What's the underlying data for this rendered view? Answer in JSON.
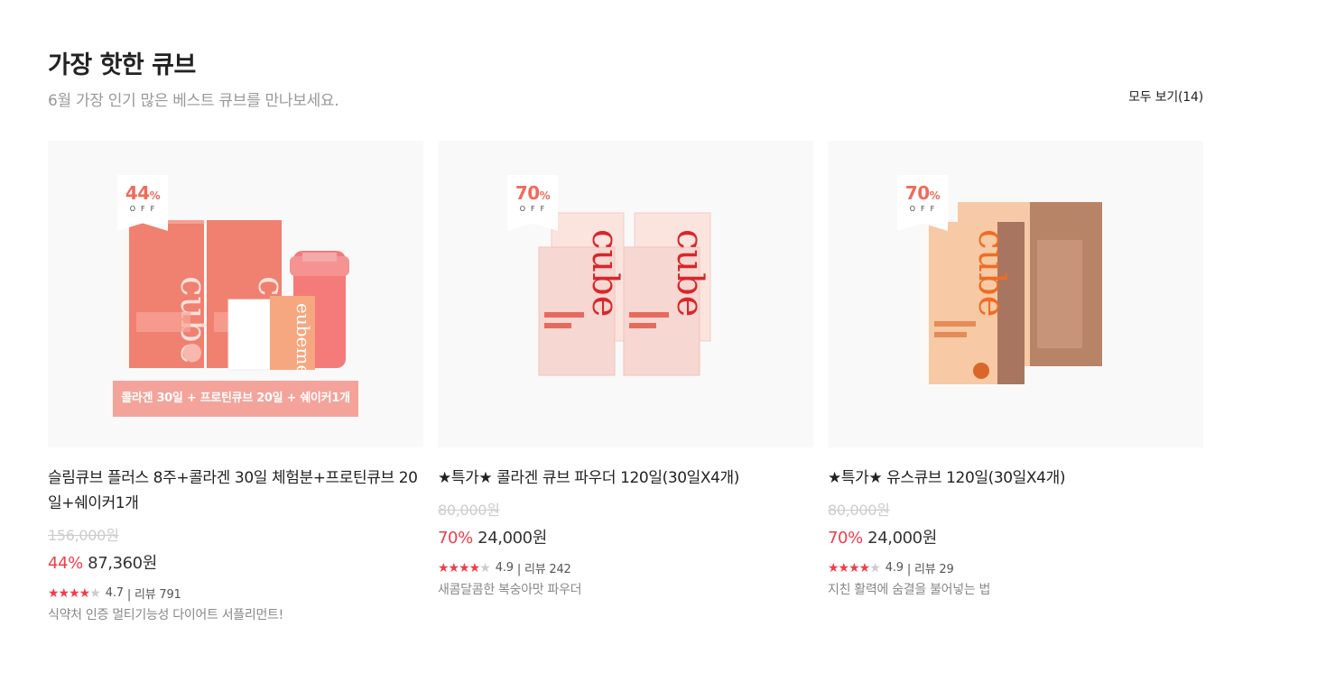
{
  "section": {
    "title": "가장 핫한 큐브",
    "subtitle": "6월 가장 인기 많은 베스트 큐브를 만나보세요.",
    "view_all": "모두 보기(14)"
  },
  "colors": {
    "discount": "#f23c4a",
    "badge": "#f06b5c",
    "thumb_bg": "#f9f9f9"
  },
  "products": [
    {
      "badge_pct": "44",
      "badge_unit": "%",
      "badge_off": "OFF",
      "strip": "콜라겐 30일 + 프로틴큐브 20일 + 쉐이커1개",
      "name": "슬림큐브 플러스 8주+콜라겐 30일 체험분+프로틴큐브 20일+쉐이커1개",
      "original_price": "156,000원",
      "discount": "44%",
      "price": "87,360원",
      "rating": "4.7",
      "review_count": "| 리뷰 791",
      "stars": "★★★★",
      "stars_empty": "★",
      "desc": "식약처 인증 멀티기능성 다이어트 서플리먼트!"
    },
    {
      "badge_pct": "70",
      "badge_unit": "%",
      "badge_off": "OFF",
      "name": "★특가★ 콜라겐 큐브 파우더 120일(30일X4개)",
      "original_price": "80,000원",
      "discount": "70%",
      "price": "24,000원",
      "rating": "4.9",
      "review_count": "| 리뷰 242",
      "stars": "★★★★",
      "stars_empty": "★",
      "desc": "새콤달콤한 복숭아맛 파우더"
    },
    {
      "badge_pct": "70",
      "badge_unit": "%",
      "badge_off": "OFF",
      "name": "★특가★ 유스큐브 120일(30일X4개)",
      "original_price": "80,000원",
      "discount": "70%",
      "price": "24,000원",
      "rating": "4.9",
      "review_count": "| 리뷰 29",
      "stars": "★★★★",
      "stars_empty": "★",
      "desc": "지친 활력에 숨결을 불어넣는 법"
    }
  ]
}
